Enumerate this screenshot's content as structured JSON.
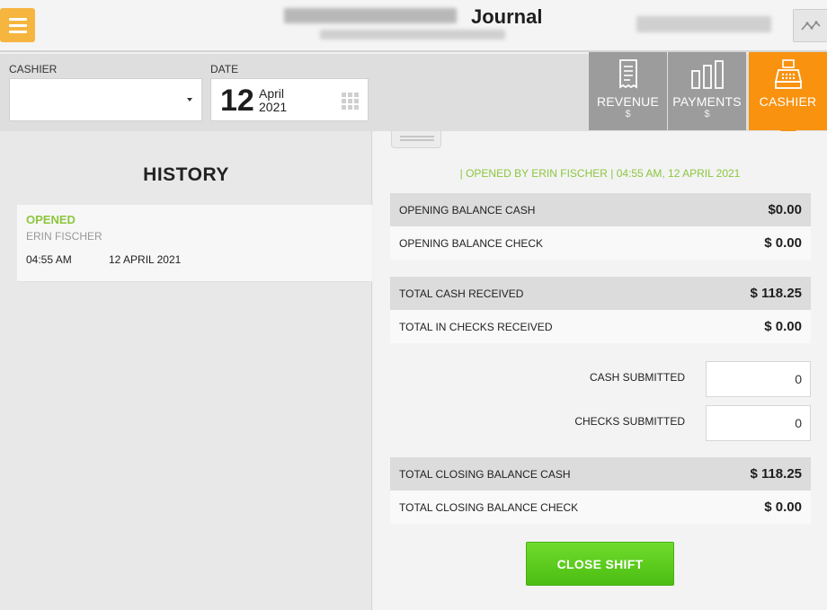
{
  "header": {
    "title": "Journal"
  },
  "filters": {
    "cashier_label": "CASHIER",
    "cashier_value": "",
    "date_label": "DATE",
    "date_day": "12",
    "date_month": "April",
    "date_year": "2021"
  },
  "tabs": [
    {
      "label": "REVENUE",
      "sub": "$",
      "icon": "receipt-icon",
      "active": false
    },
    {
      "label": "PAYMENTS",
      "sub": "$",
      "icon": "bar-chart-icon",
      "active": false
    },
    {
      "label": "CASHIER",
      "sub": "",
      "icon": "cash-register-icon",
      "active": true
    }
  ],
  "history": {
    "title": "HISTORY",
    "items": [
      {
        "status": "OPENED",
        "name": "ERIN FISCHER",
        "time": "04:55 AM",
        "date": "12 APRIL 2021"
      }
    ]
  },
  "shift": {
    "opened_by": "| OPENED BY ERIN FISCHER | 04:55 AM, 12 APRIL 2021",
    "rows": {
      "opening_cash": {
        "label": "OPENING BALANCE CASH",
        "value": "$0.00"
      },
      "opening_check": {
        "label": "OPENING BALANCE CHECK",
        "value": "$ 0.00"
      },
      "total_cash": {
        "label": "TOTAL CASH RECEIVED",
        "value": "$ 118.25"
      },
      "total_checks": {
        "label": "TOTAL IN CHECKS RECEIVED",
        "value": "$ 0.00"
      },
      "closing_cash": {
        "label": "TOTAL CLOSING BALANCE CASH",
        "value": "$ 118.25"
      },
      "closing_check": {
        "label": "TOTAL CLOSING BALANCE CHECK",
        "value": "$ 0.00"
      }
    },
    "cash_submitted": {
      "label": "CASH SUBMITTED",
      "value": "0"
    },
    "checks_submitted": {
      "label": "CHECKS SUBMITTED",
      "value": "0"
    },
    "close_button": "CLOSE SHIFT"
  },
  "colors": {
    "accent_orange": "#f8920f",
    "menu_yellow": "#f6b53f",
    "status_green": "#8cc63f",
    "button_green": "#5ccd1f",
    "tab_gray": "#9c9c9c"
  }
}
